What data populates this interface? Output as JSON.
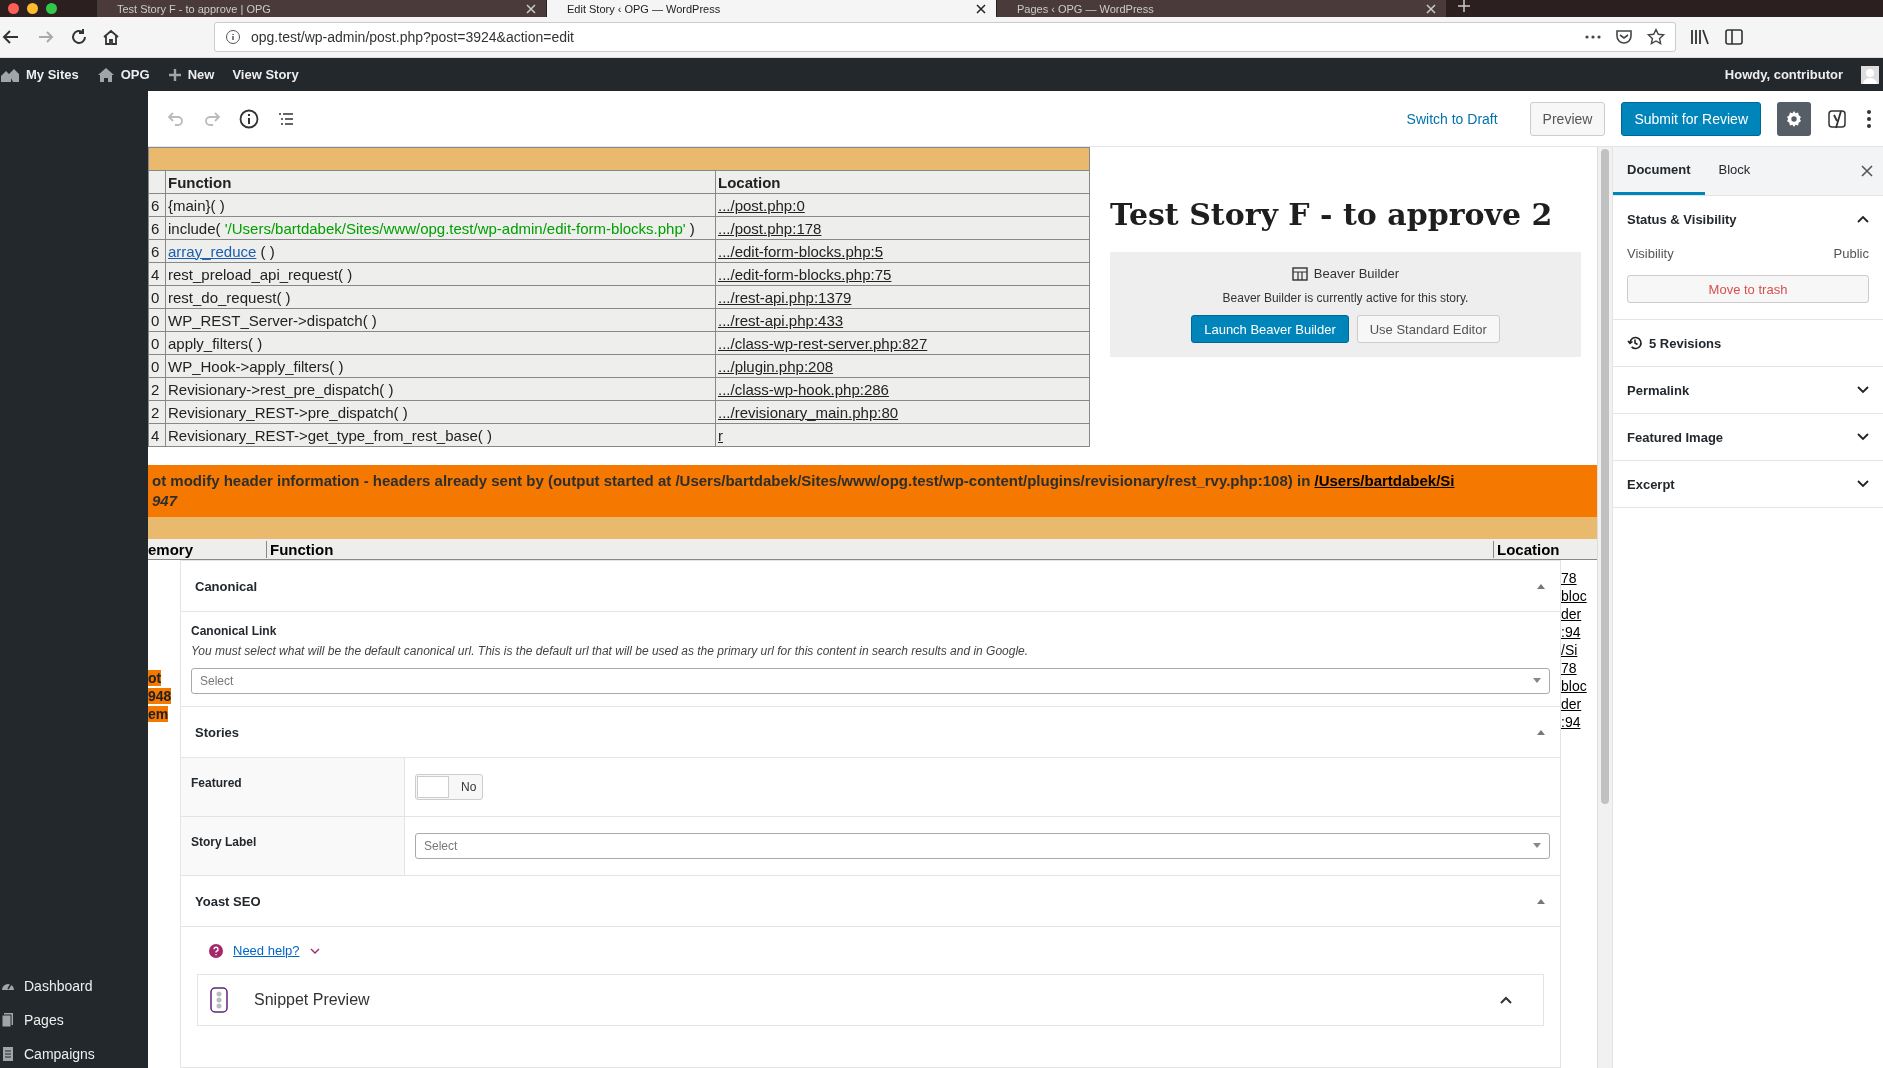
{
  "browser": {
    "tabs": [
      {
        "title": "Test Story F - to approve | OPG",
        "selected": false
      },
      {
        "title": "Edit Story ‹ OPG — WordPress",
        "selected": true
      },
      {
        "title": "Pages ‹ OPG — WordPress",
        "selected": false
      }
    ],
    "url": "opg.test/wp-admin/post.php?post=3924&action=edit"
  },
  "admin_bar": {
    "items": [
      {
        "label": "My Sites",
        "kind": "sites"
      },
      {
        "label": "OPG",
        "kind": "home"
      },
      {
        "label": "New",
        "kind": "add"
      },
      {
        "label": "View Story",
        "kind": "plain"
      }
    ],
    "account": "Howdy, contributor"
  },
  "sidebar": {
    "items": [
      {
        "label": "Dashboard",
        "kind": "dashboard"
      },
      {
        "label": "Pages",
        "kind": "pages"
      },
      {
        "label": "Campaigns",
        "kind": "campaigns"
      }
    ]
  },
  "toolbar": {
    "switch_to_draft": "Switch to Draft",
    "preview": "Preview",
    "submit": "Submit for Review"
  },
  "debug_table": {
    "columns": [
      "Function",
      "Location"
    ],
    "rows": [
      {
        "index": "6",
        "function": [
          {
            "kind": "text",
            "text": "{main}( )"
          }
        ],
        "location": ".../post.php:0"
      },
      {
        "index": "6",
        "function": [
          {
            "kind": "text",
            "text": "include( "
          },
          {
            "kind": "string",
            "text": "'/Users/bartdabek/Sites/www/opg.test/wp-admin/edit-form-blocks.php'"
          },
          {
            "kind": "text",
            "text": " )"
          }
        ],
        "location": ".../post.php:178"
      },
      {
        "index": "6",
        "function": [
          {
            "kind": "link",
            "text": "array_reduce"
          },
          {
            "kind": "text",
            "text": " ( )"
          }
        ],
        "location": ".../edit-form-blocks.php:5"
      },
      {
        "index": "4",
        "function": [
          {
            "kind": "text",
            "text": "rest_preload_api_request( )"
          }
        ],
        "location": ".../edit-form-blocks.php:75"
      },
      {
        "index": "0",
        "function": [
          {
            "kind": "text",
            "text": "rest_do_request( )"
          }
        ],
        "location": ".../rest-api.php:1379"
      },
      {
        "index": "0",
        "function": [
          {
            "kind": "text",
            "text": "WP_REST_Server->dispatch( )"
          }
        ],
        "location": ".../rest-api.php:433"
      },
      {
        "index": "0",
        "function": [
          {
            "kind": "text",
            "text": "apply_filters( )"
          }
        ],
        "location": ".../class-wp-rest-server.php:827"
      },
      {
        "index": "0",
        "function": [
          {
            "kind": "text",
            "text": "WP_Hook->apply_filters( )"
          }
        ],
        "location": ".../plugin.php:208"
      },
      {
        "index": "2",
        "function": [
          {
            "kind": "text",
            "text": "Revisionary->rest_pre_dispatch( )"
          }
        ],
        "location": ".../class-wp-hook.php:286"
      },
      {
        "index": "2",
        "function": [
          {
            "kind": "text",
            "text": "Revisionary_REST->pre_dispatch( )"
          }
        ],
        "location": ".../revisionary_main.php:80"
      },
      {
        "index": "4",
        "function": [
          {
            "kind": "text",
            "text": "Revisionary_REST->get_type_from_rest_base( )"
          }
        ],
        "location": "r"
      }
    ]
  },
  "post_title": "Test Story F - to approve 2",
  "beaver_builder": {
    "label": "Beaver Builder",
    "notice": "Beaver Builder is currently active for this story.",
    "launch": "Launch Beaver Builder",
    "standard": "Use Standard Editor"
  },
  "error": {
    "message": "ot modify header information - headers already sent by (output started at /Users/bartdabek/Sites/www/opg.test/wp-content/plugins/revisionary/rest_rvy.php:108) in",
    "link": "/Users/bartdabek/Si",
    "line_2": "947"
  },
  "debug_table_2": {
    "columns": [
      "emory",
      "Function",
      "Location"
    ]
  },
  "left_fragments": [
    "ot",
    "948",
    "em"
  ],
  "right_fragments": [
    "78",
    "bloc",
    "der",
    ":94",
    "/Si",
    "78",
    "bloc",
    "der",
    ":94"
  ],
  "canonical": {
    "title": "Canonical",
    "expanded": true,
    "field_label": "Canonical Link",
    "description": "You must select what will be the default canonical url. This is the default url that will be used as the primary url for this content in search results and in Google.",
    "select": {
      "placeholder": "Select"
    }
  },
  "stories": {
    "title": "Stories",
    "expanded": true,
    "featured": {
      "label": "Featured",
      "on": false,
      "value": "No"
    },
    "story_label": {
      "label": "Story Label",
      "placeholder": "Select"
    }
  },
  "yoast": {
    "title": "Yoast SEO",
    "expanded": true,
    "help": "Need help?",
    "snippet": "Snippet Preview"
  },
  "settings": {
    "tabs": [
      {
        "label": "Document",
        "selected": true
      },
      {
        "label": "Block",
        "selected": false
      }
    ],
    "status": {
      "title": "Status & Visibility",
      "expanded": true,
      "visibility_label": "Visibility",
      "visibility": "Public",
      "trash": "Move to trash"
    },
    "revisions": "5 Revisions",
    "panels": [
      {
        "title": "Permalink",
        "expanded": false
      },
      {
        "title": "Featured Image",
        "expanded": false
      },
      {
        "title": "Excerpt",
        "expanded": false
      }
    ]
  }
}
